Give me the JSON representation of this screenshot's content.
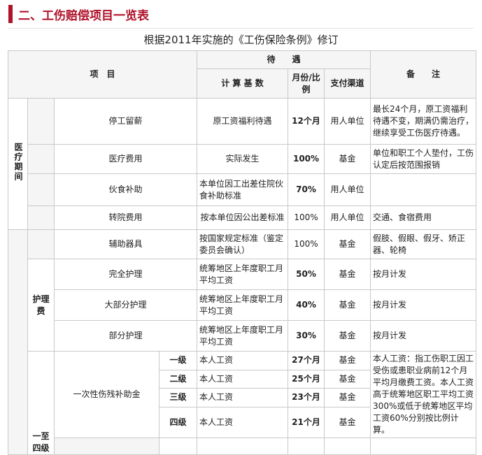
{
  "heading": {
    "title": "二、工伤赔偿项目一览表"
  },
  "subtitle": "根据2011年实施的《工伤保险条例》修订",
  "table": {
    "headers": {
      "item": "项　目",
      "treatment": "待　　遇",
      "basis": "计 算 基 数",
      "ratio": "月份/比例",
      "channel": "支付渠道",
      "remark": "备　　注"
    },
    "groups": {
      "medical": "医疗期间",
      "nursing": "护理费",
      "grade": "一至四级"
    },
    "rows": [
      {
        "item": "停工留薪",
        "basis": "原工资福利待遇",
        "ratio": "12个月",
        "channel": "用人单位",
        "remark": "最长24个月，原工资福利待遇不变，期满仍需治疗，继续享受工伤医疗待遇。"
      },
      {
        "item": "医疗费用",
        "basis": "实际发生",
        "ratio": "100%",
        "channel": "基金",
        "remark": "单位和职工个人垫付，工伤认定后按范围报销"
      },
      {
        "item": "伙食补助",
        "basis": "本单位因工出差住院伙食补助标准",
        "ratio": "70%",
        "channel": "用人单位",
        "remark": ""
      },
      {
        "item": "转院费用",
        "basis": "按本单位因公出差标准",
        "ratio": "100%",
        "channel": "用人单位",
        "remark": "交通、食宿费用"
      },
      {
        "item": "辅助器具",
        "basis": "按国家规定标准（鉴定委员会确认）",
        "ratio": "100%",
        "channel": "基金",
        "remark": "假肢、假眼、假牙、矫正器、轮椅"
      },
      {
        "item": "完全护理",
        "basis": "统筹地区上年度职工月平均工资",
        "ratio": "50%",
        "channel": "基金",
        "remark": "按月计发"
      },
      {
        "item": "大部分护理",
        "basis": "统筹地区上年度职工月平均工资",
        "ratio": "40%",
        "channel": "基金",
        "remark": "按月计发"
      },
      {
        "item": "部分护理",
        "basis": "统筹地区上年度职工月平均工资",
        "ratio": "30%",
        "channel": "基金",
        "remark": "按月计发"
      }
    ],
    "disability": {
      "item": "一次性伤残补助金",
      "remark": "本人工资：指工伤职工因工受伤或患职业病前12个月平均月缴费工资。本人工资高于统筹地区职工平均工资300%或低于统筹地区平均工资60%分别按比例计算。",
      "grades": [
        {
          "grade": "一级",
          "basis": "本人工资",
          "ratio": "27个月",
          "channel": "基金"
        },
        {
          "grade": "二级",
          "basis": "本人工资",
          "ratio": "25个月",
          "channel": "基金"
        },
        {
          "grade": "三级",
          "basis": "本人工资",
          "ratio": "23个月",
          "channel": "基金"
        },
        {
          "grade": "四级",
          "basis": "本人工资",
          "ratio": "21个月",
          "channel": "基金"
        }
      ]
    }
  }
}
